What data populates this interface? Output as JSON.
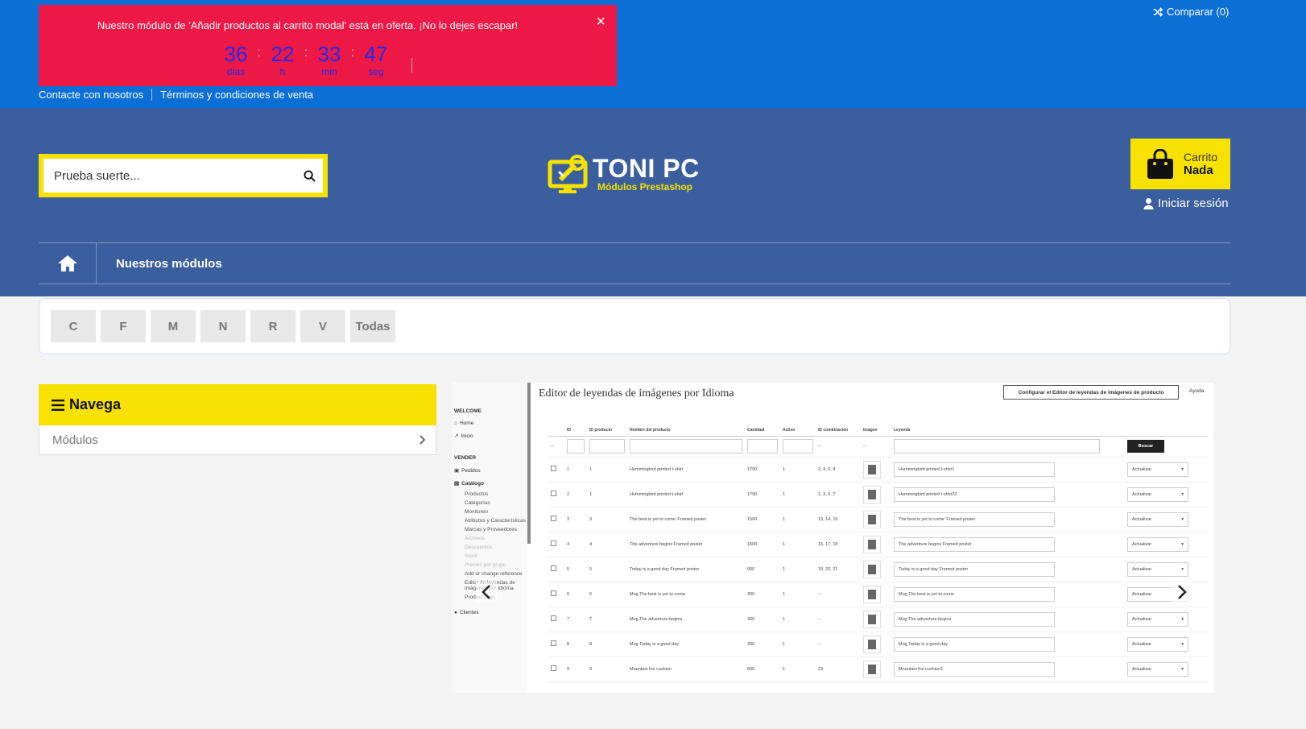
{
  "promo": {
    "text": "Nuestro módulo de 'Añadir productos al carrito modal' está en oferta. ¡No lo dejes escapar!",
    "close": "×",
    "countdown": [
      {
        "value": "36",
        "label": "días"
      },
      {
        "value": "22",
        "label": "h"
      },
      {
        "value": "33",
        "label": "min"
      },
      {
        "value": "47",
        "label": "seg"
      }
    ],
    "separator": ":"
  },
  "compare": {
    "label": "Comparar (0)",
    "icon": "shuffle-icon"
  },
  "toplinks": [
    "Contacte con nosotros",
    "Términos y condiciones de venta"
  ],
  "search": {
    "placeholder": "Prueba suerte...",
    "icon": "search-icon"
  },
  "logo": {
    "title": "TONI PC",
    "subtitle": "Módulos Prestashop"
  },
  "cart": {
    "label": "Carrito",
    "value": "Nada",
    "icon": "shopping-bag-icon"
  },
  "login": {
    "label": "Iniciar sesión",
    "icon": "user-icon"
  },
  "nav": {
    "home_icon": "home-icon",
    "items": [
      "Nuestros módulos"
    ]
  },
  "letters": [
    "C",
    "F",
    "M",
    "N",
    "R",
    "V",
    "Todas"
  ],
  "sidebar": {
    "title": "Navega",
    "icon": "menu-icon",
    "items": [
      {
        "label": "Módulos",
        "icon": "chevron-right-icon"
      }
    ]
  },
  "screenshot": {
    "title": "Editor de leyendas de imágenes por Idioma",
    "config_button": "Configurar el Editor de leyendas de imágenes de producto",
    "help": "Ayuda",
    "side": {
      "welcome": "WELCOME",
      "home": "Home",
      "inicio": "Inicio",
      "vender": "VENDER",
      "pedidos": "Pedidos",
      "catalogo": "Catálogo",
      "subitems": [
        "Productos",
        "Categorías",
        "Monitoreo",
        "Atributos y Características",
        "Marcas y Proveedores",
        "Archivos",
        "Descuentos",
        "Stock",
        "Precios por grupo",
        "Add or change reference",
        "Editor de leyendas de imágenes por Idioma",
        "Product flags"
      ],
      "clientes": "Clientes"
    },
    "columns": [
      "ID",
      "ID producto",
      "Nombre del producto",
      "Cantidad",
      "Activo",
      "ID combinación",
      "Imagen",
      "Leyenda"
    ],
    "search_button": "Buscar",
    "filter_dash": "--",
    "action_label": "Actualizar",
    "rows": [
      {
        "id": "1",
        "pid": "1",
        "name": "Hummingbird printed t-shirt",
        "qty": "1790",
        "active": "1",
        "comb": "2, 4, 6, 8",
        "caption": "Hummingbird printed t-shirt1"
      },
      {
        "id": "2",
        "pid": "1",
        "name": "Hummingbird printed t-shirt",
        "qty": "1790",
        "active": "1",
        "comb": "1, 3, 5, 7",
        "caption": "Hummingbird printed t-shirt22"
      },
      {
        "id": "3",
        "pid": "3",
        "name": "The best is yet to come' Framed poster",
        "qty": "1500",
        "active": "1",
        "comb": "13, 14, 15",
        "caption": "The best is yet to come' Framed poster"
      },
      {
        "id": "4",
        "pid": "4",
        "name": "The adventure begins Framed poster",
        "qty": "1500",
        "active": "1",
        "comb": "16, 17, 18",
        "caption": "The adventure begins Framed poster"
      },
      {
        "id": "5",
        "pid": "5",
        "name": "Today is a good day Framed poster",
        "qty": "900",
        "active": "1",
        "comb": "19, 20, 21",
        "caption": "Today is a good day Framed poster"
      },
      {
        "id": "6",
        "pid": "6",
        "name": "Mug The best is yet to come",
        "qty": "300",
        "active": "1",
        "comb": "--",
        "caption": "Mug The best is yet to come"
      },
      {
        "id": "7",
        "pid": "7",
        "name": "Mug The adventure begins",
        "qty": "300",
        "active": "1",
        "comb": "--",
        "caption": "Mug The adventure begins"
      },
      {
        "id": "8",
        "pid": "8",
        "name": "Mug Today is a good day",
        "qty": "300",
        "active": "1",
        "comb": "--",
        "caption": "Mug Today is a good day"
      },
      {
        "id": "9",
        "pid": "9",
        "name": "Mountain fox cushion",
        "qty": "600",
        "active": "1",
        "comb": "23",
        "caption": "Mountain fox cushion1"
      }
    ],
    "prev_icon": "chevron-left-icon",
    "next_icon": "chevron-right-icon"
  },
  "colors": {
    "top_bar": "#0b6fd6",
    "promo": "#ee1846",
    "header": "#3a5e9e",
    "accent": "#f7e100"
  }
}
